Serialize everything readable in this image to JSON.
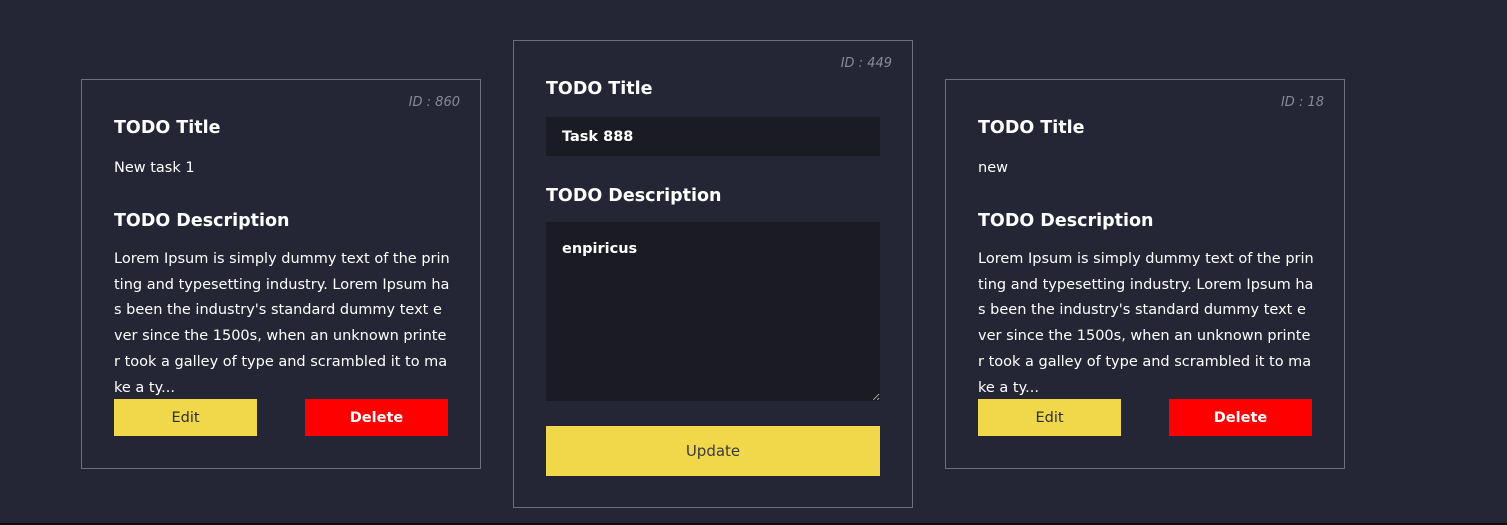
{
  "cards": [
    {
      "id_label": "ID : 860",
      "title_heading": "TODO Title",
      "title": "New task 1",
      "description_heading": "TODO Description",
      "description": "Lorem Ipsum is simply dummy text of the printing and typesetting industry. Lorem Ipsum has been the industry's standard dummy text ever since the 1500s, when an unknown printer took a galley of type and scrambled it to make a ty...",
      "edit_label": "Edit",
      "delete_label": "Delete"
    },
    {
      "id_label": "ID : 449",
      "title_heading": "TODO Title",
      "title_value": "Task 888",
      "description_heading": "TODO Description",
      "description_value": "enpiricus",
      "update_label": "Update"
    },
    {
      "id_label": "ID : 18",
      "title_heading": "TODO Title",
      "title": "new",
      "description_heading": "TODO Description",
      "description": "Lorem Ipsum is simply dummy text of the printing and typesetting industry. Lorem Ipsum has been the industry's standard dummy text ever since the 1500s, when an unknown printer took a galley of type and scrambled it to make a ty...",
      "edit_label": "Edit",
      "delete_label": "Delete"
    }
  ],
  "colors": {
    "background": "#252635",
    "card_border": "#6e6e7a",
    "field_background": "#1b1b24",
    "edit_button": "#f0d84a",
    "delete_button": "#ff0000",
    "update_button": "#f0d84a"
  }
}
